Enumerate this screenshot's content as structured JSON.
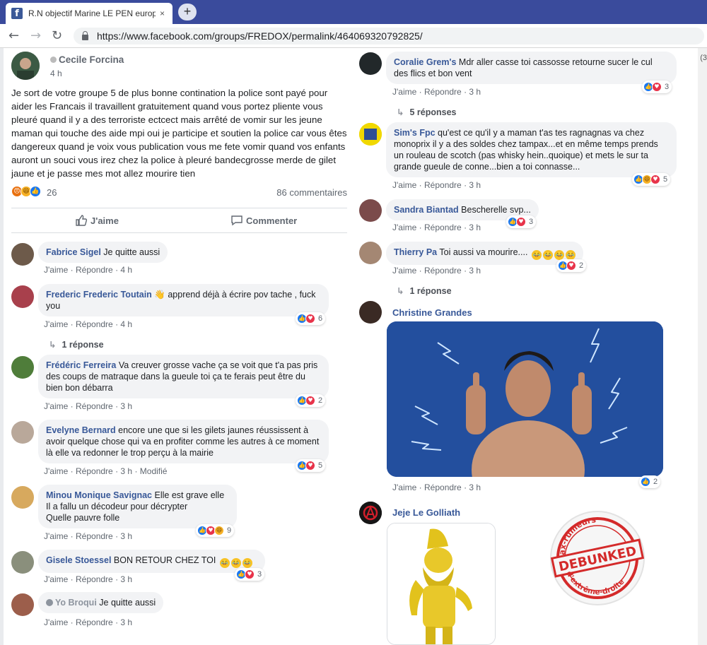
{
  "browser": {
    "tab_title": "R.N objectif Marine LE PEN europ",
    "tab_close": "×",
    "new_tab": "+",
    "url": "https://www.facebook.com/groups/FREDOX/permalink/464069320792825/",
    "right_edge_text": "(3"
  },
  "post": {
    "author": "Cecile Forcina",
    "time": "4 h",
    "body": "Je sort de votre groupe 5 de plus bonne contination la police sont payé pour aider les Francais il travaillent gratuitement quand vous portez pliente vous pleuré quand il y a des terroriste ectcect mais arrêté de vomir sur les jeune maman qui touche des aide mpi oui je participe et soutien la police car vous êtes dangereux quand je voix vous publication vous me fete vomir quand vos enfants auront un souci vous irez chez la police à pleuré bandecgrosse merde de gilet jaune et je passe mes mot allez mourire tien",
    "reaction_count": "26",
    "comment_count": "86 commentaires",
    "like_label": "J'aime",
    "comment_label": "Commenter"
  },
  "meta_labels": {
    "like": "J'aime",
    "reply": "Répondre",
    "sep": "·",
    "modified": "Modifié"
  },
  "left_comments": [
    {
      "name": "Fabrice Sigel",
      "text": "Je quitte aussi",
      "time": "4 h"
    },
    {
      "name": "Frederic Frederic Toutain",
      "text": "👋 apprend déjà à écrire pov tache , fuck you",
      "time": "4 h",
      "reactions": "6",
      "replies": "1 réponse"
    },
    {
      "name": "Frédéric Ferreira",
      "text": "Va creuver grosse vache ça se voit que t'a pas pris des coups de matraque dans la gueule toi ça te ferais peut être du bien bon débarra",
      "time": "3 h",
      "reactions": "2"
    },
    {
      "name": "Evelyne Bernard",
      "text": "encore une que si les gilets jaunes réussissent à avoir quelque chose qui va en profiter comme les autres à ce moment là elle va redonner le trop perçu à la mairie",
      "time": "3 h",
      "reactions": "5"
    },
    {
      "name": "Minou Monique Savignac",
      "text_lines": [
        "Elle est grave elle",
        "Il a fallu un décodeur pour décrypter",
        "Quelle pauvre folle"
      ],
      "time": "3 h",
      "reactions": "9"
    },
    {
      "name": "Gisele Stoessel",
      "text": "BON RETOUR CHEZ TOI",
      "time": "3 h",
      "reactions": "3"
    },
    {
      "name": "Yo Broqui",
      "text": "Je quitte aussi",
      "time": "3 h"
    }
  ],
  "right_comments": [
    {
      "name": "Coralie Grem's",
      "text": "Mdr aller casse toi cassosse retourne sucer le cul des flics et bon vent",
      "time": "3 h",
      "reactions": "3",
      "replies": "5 réponses"
    },
    {
      "name": "Sim's Fpc",
      "text": "qu'est ce qu'il y a maman t'as tes ragnagnas va chez monoprix il y a des soldes chez tampax...et en même temps prends un rouleau de scotch (pas whisky hein..quoique) et mets le sur ta grande gueule de conne...bien a toi connasse...",
      "time": "3 h",
      "reactions": "5"
    },
    {
      "name": "Sandra Biantad",
      "text": "Bescherelle svp...",
      "time": "3 h",
      "reactions": "3"
    },
    {
      "name": "Thierry Pa",
      "text": "Toi aussi va mourire....",
      "time": "3 h",
      "reactions": "2",
      "replies": "1 réponse"
    },
    {
      "name": "Christine Grandes",
      "time": "3 h",
      "reactions": "2"
    },
    {
      "name": "Jeje Le Golliath"
    }
  ],
  "stamp": {
    "top": "Hoax-rumeurs",
    "middle": "DEBUNKED",
    "bottom": "d'extrême-droite"
  },
  "colors": {
    "facebook_blue": "#385898",
    "tab_bar": "#3a4b9c",
    "like": "#1877f2",
    "love": "#e8334a",
    "haha": "#f7b125",
    "stamp_red": "#d42a2a"
  }
}
